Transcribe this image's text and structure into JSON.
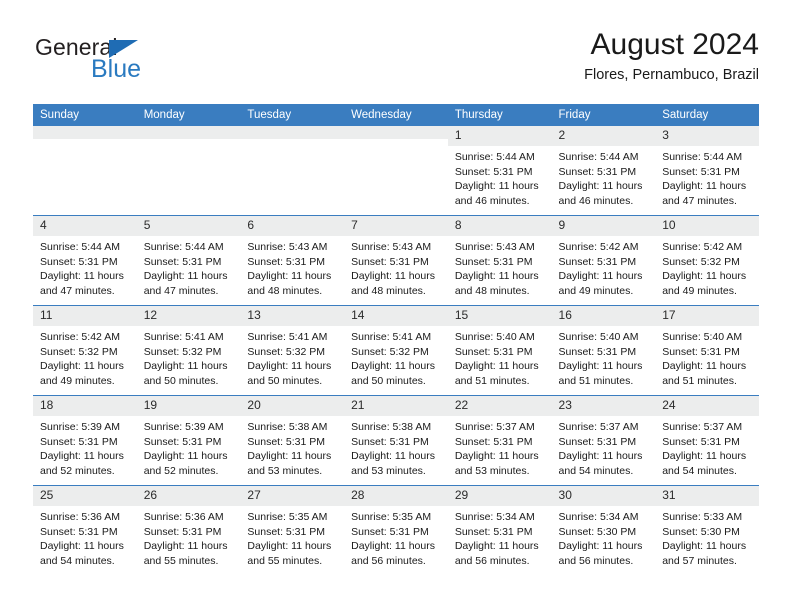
{
  "brand": {
    "name_part1": "General",
    "name_part2": "Blue",
    "triangle_icon": "triangle-icon",
    "accent_color": "#2a7ac0"
  },
  "header": {
    "title": "August 2024",
    "subtitle": "Flores, Pernambuco, Brazil"
  },
  "calendar": {
    "header_bg": "#3a7dc0",
    "daynum_bg": "#eceded",
    "weekdays": [
      "Sunday",
      "Monday",
      "Tuesday",
      "Wednesday",
      "Thursday",
      "Friday",
      "Saturday"
    ],
    "weeks": [
      [
        {
          "day": "",
          "sunrise": "",
          "sunset": "",
          "daylight1": "",
          "daylight2": ""
        },
        {
          "day": "",
          "sunrise": "",
          "sunset": "",
          "daylight1": "",
          "daylight2": ""
        },
        {
          "day": "",
          "sunrise": "",
          "sunset": "",
          "daylight1": "",
          "daylight2": ""
        },
        {
          "day": "",
          "sunrise": "",
          "sunset": "",
          "daylight1": "",
          "daylight2": ""
        },
        {
          "day": "1",
          "sunrise": "Sunrise: 5:44 AM",
          "sunset": "Sunset: 5:31 PM",
          "daylight1": "Daylight: 11 hours",
          "daylight2": "and 46 minutes."
        },
        {
          "day": "2",
          "sunrise": "Sunrise: 5:44 AM",
          "sunset": "Sunset: 5:31 PM",
          "daylight1": "Daylight: 11 hours",
          "daylight2": "and 46 minutes."
        },
        {
          "day": "3",
          "sunrise": "Sunrise: 5:44 AM",
          "sunset": "Sunset: 5:31 PM",
          "daylight1": "Daylight: 11 hours",
          "daylight2": "and 47 minutes."
        }
      ],
      [
        {
          "day": "4",
          "sunrise": "Sunrise: 5:44 AM",
          "sunset": "Sunset: 5:31 PM",
          "daylight1": "Daylight: 11 hours",
          "daylight2": "and 47 minutes."
        },
        {
          "day": "5",
          "sunrise": "Sunrise: 5:44 AM",
          "sunset": "Sunset: 5:31 PM",
          "daylight1": "Daylight: 11 hours",
          "daylight2": "and 47 minutes."
        },
        {
          "day": "6",
          "sunrise": "Sunrise: 5:43 AM",
          "sunset": "Sunset: 5:31 PM",
          "daylight1": "Daylight: 11 hours",
          "daylight2": "and 48 minutes."
        },
        {
          "day": "7",
          "sunrise": "Sunrise: 5:43 AM",
          "sunset": "Sunset: 5:31 PM",
          "daylight1": "Daylight: 11 hours",
          "daylight2": "and 48 minutes."
        },
        {
          "day": "8",
          "sunrise": "Sunrise: 5:43 AM",
          "sunset": "Sunset: 5:31 PM",
          "daylight1": "Daylight: 11 hours",
          "daylight2": "and 48 minutes."
        },
        {
          "day": "9",
          "sunrise": "Sunrise: 5:42 AM",
          "sunset": "Sunset: 5:31 PM",
          "daylight1": "Daylight: 11 hours",
          "daylight2": "and 49 minutes."
        },
        {
          "day": "10",
          "sunrise": "Sunrise: 5:42 AM",
          "sunset": "Sunset: 5:32 PM",
          "daylight1": "Daylight: 11 hours",
          "daylight2": "and 49 minutes."
        }
      ],
      [
        {
          "day": "11",
          "sunrise": "Sunrise: 5:42 AM",
          "sunset": "Sunset: 5:32 PM",
          "daylight1": "Daylight: 11 hours",
          "daylight2": "and 49 minutes."
        },
        {
          "day": "12",
          "sunrise": "Sunrise: 5:41 AM",
          "sunset": "Sunset: 5:32 PM",
          "daylight1": "Daylight: 11 hours",
          "daylight2": "and 50 minutes."
        },
        {
          "day": "13",
          "sunrise": "Sunrise: 5:41 AM",
          "sunset": "Sunset: 5:32 PM",
          "daylight1": "Daylight: 11 hours",
          "daylight2": "and 50 minutes."
        },
        {
          "day": "14",
          "sunrise": "Sunrise: 5:41 AM",
          "sunset": "Sunset: 5:32 PM",
          "daylight1": "Daylight: 11 hours",
          "daylight2": "and 50 minutes."
        },
        {
          "day": "15",
          "sunrise": "Sunrise: 5:40 AM",
          "sunset": "Sunset: 5:31 PM",
          "daylight1": "Daylight: 11 hours",
          "daylight2": "and 51 minutes."
        },
        {
          "day": "16",
          "sunrise": "Sunrise: 5:40 AM",
          "sunset": "Sunset: 5:31 PM",
          "daylight1": "Daylight: 11 hours",
          "daylight2": "and 51 minutes."
        },
        {
          "day": "17",
          "sunrise": "Sunrise: 5:40 AM",
          "sunset": "Sunset: 5:31 PM",
          "daylight1": "Daylight: 11 hours",
          "daylight2": "and 51 minutes."
        }
      ],
      [
        {
          "day": "18",
          "sunrise": "Sunrise: 5:39 AM",
          "sunset": "Sunset: 5:31 PM",
          "daylight1": "Daylight: 11 hours",
          "daylight2": "and 52 minutes."
        },
        {
          "day": "19",
          "sunrise": "Sunrise: 5:39 AM",
          "sunset": "Sunset: 5:31 PM",
          "daylight1": "Daylight: 11 hours",
          "daylight2": "and 52 minutes."
        },
        {
          "day": "20",
          "sunrise": "Sunrise: 5:38 AM",
          "sunset": "Sunset: 5:31 PM",
          "daylight1": "Daylight: 11 hours",
          "daylight2": "and 53 minutes."
        },
        {
          "day": "21",
          "sunrise": "Sunrise: 5:38 AM",
          "sunset": "Sunset: 5:31 PM",
          "daylight1": "Daylight: 11 hours",
          "daylight2": "and 53 minutes."
        },
        {
          "day": "22",
          "sunrise": "Sunrise: 5:37 AM",
          "sunset": "Sunset: 5:31 PM",
          "daylight1": "Daylight: 11 hours",
          "daylight2": "and 53 minutes."
        },
        {
          "day": "23",
          "sunrise": "Sunrise: 5:37 AM",
          "sunset": "Sunset: 5:31 PM",
          "daylight1": "Daylight: 11 hours",
          "daylight2": "and 54 minutes."
        },
        {
          "day": "24",
          "sunrise": "Sunrise: 5:37 AM",
          "sunset": "Sunset: 5:31 PM",
          "daylight1": "Daylight: 11 hours",
          "daylight2": "and 54 minutes."
        }
      ],
      [
        {
          "day": "25",
          "sunrise": "Sunrise: 5:36 AM",
          "sunset": "Sunset: 5:31 PM",
          "daylight1": "Daylight: 11 hours",
          "daylight2": "and 54 minutes."
        },
        {
          "day": "26",
          "sunrise": "Sunrise: 5:36 AM",
          "sunset": "Sunset: 5:31 PM",
          "daylight1": "Daylight: 11 hours",
          "daylight2": "and 55 minutes."
        },
        {
          "day": "27",
          "sunrise": "Sunrise: 5:35 AM",
          "sunset": "Sunset: 5:31 PM",
          "daylight1": "Daylight: 11 hours",
          "daylight2": "and 55 minutes."
        },
        {
          "day": "28",
          "sunrise": "Sunrise: 5:35 AM",
          "sunset": "Sunset: 5:31 PM",
          "daylight1": "Daylight: 11 hours",
          "daylight2": "and 56 minutes."
        },
        {
          "day": "29",
          "sunrise": "Sunrise: 5:34 AM",
          "sunset": "Sunset: 5:31 PM",
          "daylight1": "Daylight: 11 hours",
          "daylight2": "and 56 minutes."
        },
        {
          "day": "30",
          "sunrise": "Sunrise: 5:34 AM",
          "sunset": "Sunset: 5:30 PM",
          "daylight1": "Daylight: 11 hours",
          "daylight2": "and 56 minutes."
        },
        {
          "day": "31",
          "sunrise": "Sunrise: 5:33 AM",
          "sunset": "Sunset: 5:30 PM",
          "daylight1": "Daylight: 11 hours",
          "daylight2": "and 57 minutes."
        }
      ]
    ]
  }
}
